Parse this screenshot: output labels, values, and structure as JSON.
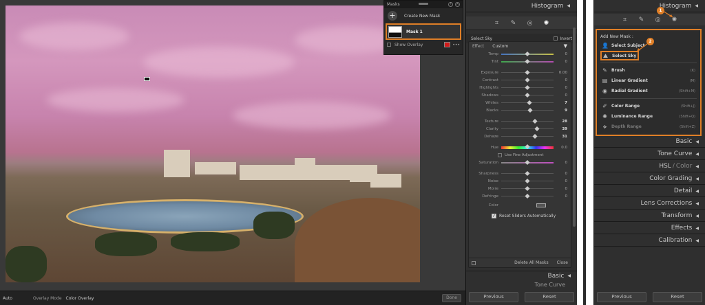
{
  "toolbar": {
    "auto_label": "Auto",
    "overlay_mode_label": "Overlay Mode",
    "overlay_mode_value": "Color Overlay",
    "done_label": "Done"
  },
  "masks_panel": {
    "title": "Masks",
    "create_label": "Create New Mask",
    "mask_name": "Mask 1",
    "show_overlay_label": "Show Overlay",
    "overlay_color": "#d01a1a"
  },
  "mid_panel": {
    "histogram_label": "Histogram",
    "mask_name": "Select Sky",
    "invert_label": "Invert",
    "effect_label": "Effect",
    "effect_value": "Custom",
    "sliders_group1": [
      {
        "label": "Temp",
        "value": "0",
        "pos": 0.5,
        "track": "temp"
      },
      {
        "label": "Tint",
        "value": "0",
        "pos": 0.5,
        "track": "tint"
      }
    ],
    "sliders_group2": [
      {
        "label": "Exposure",
        "value": "0.00",
        "pos": 0.5,
        "track": ""
      },
      {
        "label": "Contrast",
        "value": "0",
        "pos": 0.5,
        "track": ""
      },
      {
        "label": "Highlights",
        "value": "0",
        "pos": 0.5,
        "track": ""
      },
      {
        "label": "Shadows",
        "value": "0",
        "pos": 0.5,
        "track": ""
      },
      {
        "label": "Whites",
        "value": "7",
        "pos": 0.54,
        "track": "",
        "bright": true
      },
      {
        "label": "Blacks",
        "value": "9",
        "pos": 0.55,
        "track": "",
        "bright": true
      }
    ],
    "sliders_group3": [
      {
        "label": "Texture",
        "value": "28",
        "pos": 0.64,
        "track": "",
        "bright": true
      },
      {
        "label": "Clarity",
        "value": "39",
        "pos": 0.69,
        "track": "",
        "bright": true
      },
      {
        "label": "Dehaze",
        "value": "31",
        "pos": 0.65,
        "track": "",
        "bright": true
      }
    ],
    "hue_label": "Hue",
    "hue_value": "0.0",
    "fine_adjust_label": "Use Fine Adjustment",
    "saturation_label": "Saturation",
    "saturation_value": "0",
    "sliders_group4": [
      {
        "label": "Sharpness",
        "value": "0",
        "pos": 0.5,
        "track": ""
      },
      {
        "label": "Noise",
        "value": "0",
        "pos": 0.5,
        "track": ""
      },
      {
        "label": "Moire",
        "value": "0",
        "pos": 0.5,
        "track": ""
      },
      {
        "label": "Defringe",
        "value": "0",
        "pos": 0.5,
        "track": ""
      }
    ],
    "color_label": "Color",
    "reset_auto_label": "Reset Sliders Automatically",
    "delete_all_label": "Delete All Masks",
    "close_label": "Close",
    "basic_label": "Basic",
    "tone_curve_label": "Tone Curve",
    "previous_label": "Previous",
    "reset_label": "Reset"
  },
  "right_panel": {
    "histogram_label": "Histogram",
    "add_new_mask_label": "Add New Mask :",
    "badge1": "1",
    "badge2": "2",
    "items_top": [
      {
        "name": "select-subject",
        "label": "Select Subject",
        "icon": "person-icon",
        "glyph": "👤"
      },
      {
        "name": "select-sky",
        "label": "Select Sky",
        "icon": "sky-icon",
        "glyph": "⛰"
      }
    ],
    "items_mid": [
      {
        "name": "brush",
        "label": "Brush",
        "key": "(K)",
        "icon": "brush-icon",
        "glyph": "✎"
      },
      {
        "name": "linear-gradient",
        "label": "Linear Gradient",
        "key": "(M)",
        "icon": "linear-gradient-icon",
        "glyph": "▤"
      },
      {
        "name": "radial-gradient",
        "label": "Radial Gradient",
        "key": "(Shift+M)",
        "icon": "radial-gradient-icon",
        "glyph": "◉"
      }
    ],
    "items_bottom": [
      {
        "name": "color-range",
        "label": "Color Range",
        "key": "(Shift+J)",
        "icon": "color-range-icon",
        "glyph": "✐",
        "dim": false
      },
      {
        "name": "luminance-range",
        "label": "Luminance Range",
        "key": "(Shift+Q)",
        "icon": "luminance-range-icon",
        "glyph": "✺",
        "dim": false
      },
      {
        "name": "depth-range",
        "label": "Depth Range",
        "key": "(Shift+Z)",
        "icon": "depth-range-icon",
        "glyph": "⟡",
        "dim": true
      }
    ],
    "sections": [
      "Basic",
      "Tone Curve",
      "HSL",
      "Color Grading",
      "Detail",
      "Lens Corrections",
      "Transform",
      "Effects",
      "Calibration"
    ],
    "hsl_color_suffix": "Color",
    "previous_label": "Previous",
    "reset_label": "Reset"
  },
  "colors": {
    "accent": "#e07f27",
    "panel_bg": "#2f2f2f"
  }
}
